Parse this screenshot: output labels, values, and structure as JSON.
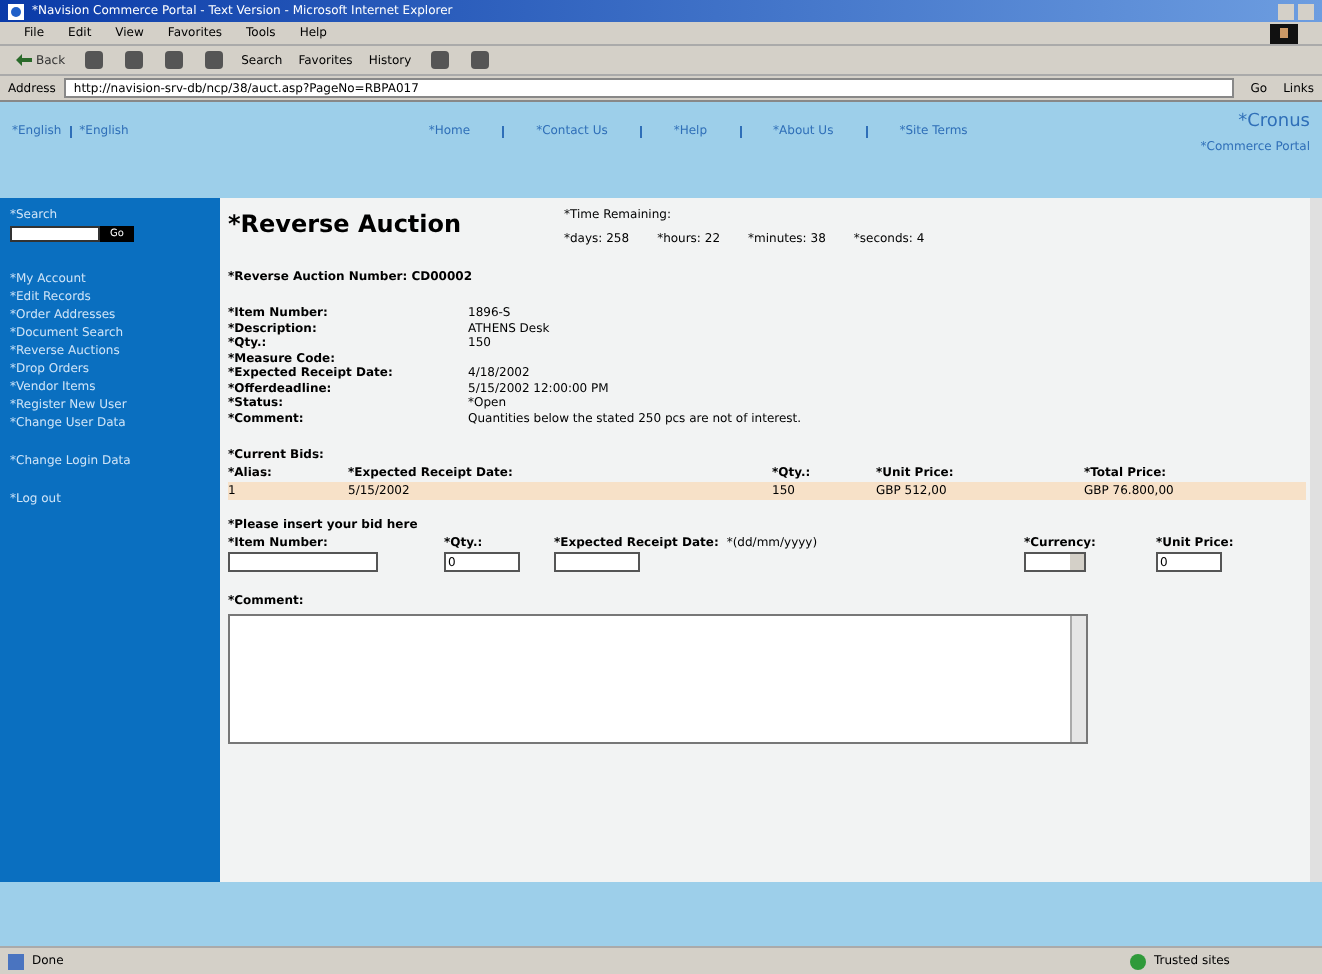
{
  "window": {
    "title": "*Navision Commerce Portal - Text Version - Microsoft Internet Explorer"
  },
  "menu": [
    "File",
    "Edit",
    "View",
    "Favorites",
    "Tools",
    "Help"
  ],
  "toolbar": {
    "back": "Back",
    "search": "Search",
    "favorites": "Favorites",
    "history": "History"
  },
  "address": {
    "label": "Address",
    "value": "http://navision-srv-db/ncp/38/auct.asp?PageNo=RBPA017",
    "go": "Go",
    "links": "Links"
  },
  "header": {
    "languages": [
      "*English",
      "*English"
    ],
    "nav": [
      "*Home",
      "*Contact Us",
      "*Help",
      "*About Us",
      "*Site Terms"
    ],
    "brand": [
      "*Cronus",
      "*Commerce Portal"
    ]
  },
  "sidebar": {
    "search_label": "*Search",
    "search_button": "Go",
    "groups": [
      [
        "*My Account",
        "*Edit Records",
        "*Order Addresses",
        "*Document Search",
        "*Reverse Auctions",
        "*Drop Orders",
        "*Vendor Items",
        "*Register New User",
        "*Change User Data"
      ],
      [
        "*Change Login Data"
      ],
      [
        "*Log out"
      ]
    ]
  },
  "page": {
    "title": "*Reverse Auction",
    "time_label": "*Time Remaining:",
    "time": [
      {
        "label": "*days:",
        "value": "258"
      },
      {
        "label": "*hours:",
        "value": "22"
      },
      {
        "label": "*minutes:",
        "value": "38"
      },
      {
        "label": "*seconds:",
        "value": "4"
      }
    ],
    "auction_number": "*Reverse Auction Number: CD00002",
    "details": [
      {
        "label": "*Item Number:",
        "value": "1896-S"
      },
      {
        "label": "*Description:",
        "value": "ATHENS Desk"
      },
      {
        "label": "*Qty.:",
        "value": "150"
      },
      {
        "label": "*Measure Code:"
      },
      {
        "label": "*Expected Receipt Date:",
        "value": "4/18/2002"
      },
      {
        "label": "*Offerdeadline:",
        "value": "5/15/2002 12:00:00 PM"
      },
      {
        "label": "*Status:",
        "value": "*Open"
      },
      {
        "label": "*Comment:",
        "value": "Quantities below the stated 250 pcs are not of interest."
      }
    ],
    "bids": {
      "title": "*Current Bids:",
      "columns": [
        "*Alias:",
        "*Expected Receipt Date:",
        "*Qty.:",
        "*Unit Price:",
        "*Total Price:"
      ],
      "rows": [
        [
          "1",
          "5/15/2002",
          "150",
          "GBP 512,00",
          "GBP 76.800,00"
        ]
      ]
    },
    "bid_form": {
      "title": "*Please insert your bid here",
      "item_number": "*Item Number:",
      "qty": "*Qty.:",
      "qty_value": "0",
      "date": "*Expected Receipt Date:",
      "date_hint": "*(dd/mm/yyyy)",
      "currency": "*Currency:",
      "unit_price": "*Unit Price:",
      "unit_price_value": "0"
    },
    "comment_label": "*Comment:"
  },
  "status_bar": {
    "text": "Done",
    "zone": "Trusted sites"
  }
}
